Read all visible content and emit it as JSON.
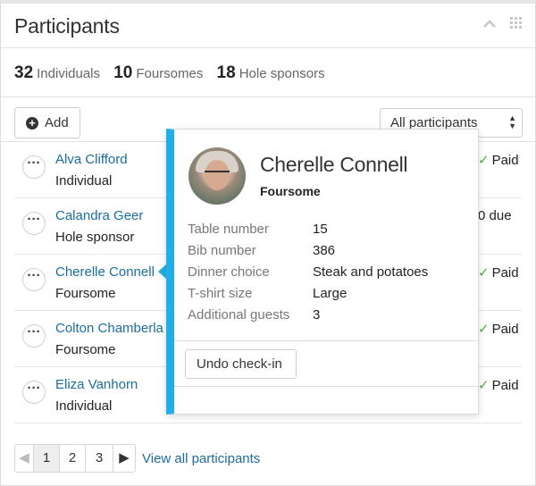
{
  "header": {
    "title": "Participants",
    "collapse_icon": "chevron-up-icon",
    "drag_icon": "grid-dots-icon"
  },
  "stats": [
    {
      "count": "32",
      "label": "Individuals"
    },
    {
      "count": "10",
      "label": "Foursomes"
    },
    {
      "count": "18",
      "label": "Hole sponsors"
    }
  ],
  "toolbar": {
    "add_label": "Add",
    "filter_value": "All participants"
  },
  "participants": [
    {
      "name": "Alva Clifford",
      "type": "Individual",
      "status": "Paid",
      "paid": true
    },
    {
      "name": "Calandra Geer",
      "type": "Hole sponsor",
      "status": "0 due",
      "paid": false
    },
    {
      "name": "Cherelle Connell",
      "type": "Foursome",
      "status": "Paid",
      "paid": true
    },
    {
      "name": "Colton Chamberla",
      "type": "Foursome",
      "status": "Paid",
      "paid": true
    },
    {
      "name": "Eliza Vanhorn",
      "type": "Individual",
      "status": "Paid",
      "paid": true
    }
  ],
  "popup": {
    "name": "Cherelle Connell",
    "type": "Foursome",
    "details": [
      {
        "label": "Table number",
        "value": "15"
      },
      {
        "label": "Bib number",
        "value": "386"
      },
      {
        "label": "Dinner choice",
        "value": "Steak and potatoes"
      },
      {
        "label": "T-shirt size",
        "value": "Large"
      },
      {
        "label": "Additional guests",
        "value": "3"
      }
    ],
    "undo_label": "Undo check-in",
    "accent_color": "#22aee6"
  },
  "pagination": {
    "pages": [
      "1",
      "2",
      "3"
    ],
    "current": "1",
    "view_all": "View all participants"
  },
  "colors": {
    "link": "#1a6ea0",
    "paid_check": "#52b043"
  }
}
